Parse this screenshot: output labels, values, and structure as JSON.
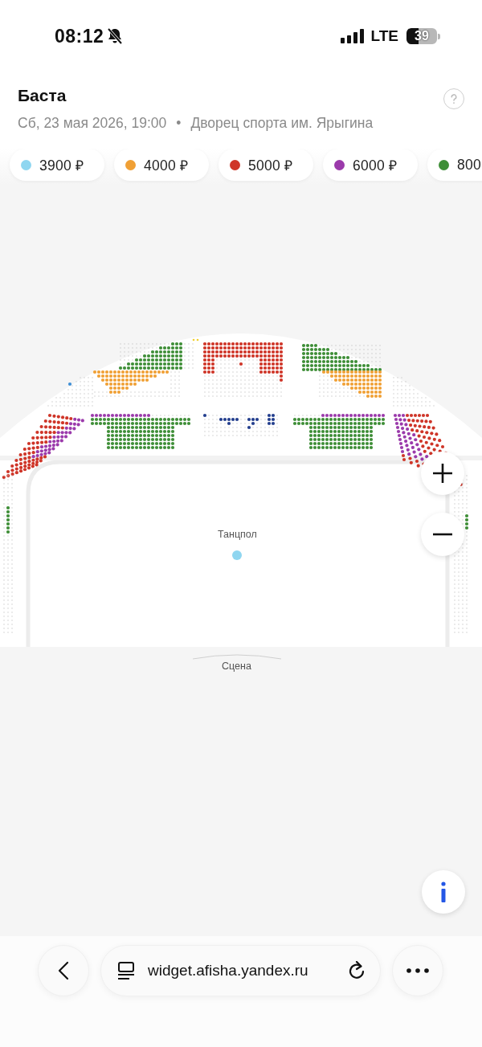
{
  "status_bar": {
    "time": "08:12",
    "network": "LTE",
    "battery": "39"
  },
  "event": {
    "title": "Баста",
    "date": "Сб, 23 мая 2026, 19:00",
    "separator": "•",
    "venue": "Дворец спорта им. Ярыгина"
  },
  "prices": [
    {
      "label": "3900 ₽",
      "color": "#8fd6f0"
    },
    {
      "label": "4000 ₽",
      "color": "#f0a035"
    },
    {
      "label": "5000 ₽",
      "color": "#cf3528"
    },
    {
      "label": "6000 ₽",
      "color": "#9b3aab"
    },
    {
      "label": "800",
      "color": "#3e8e37"
    }
  ],
  "map": {
    "dance_floor": "Танцпол",
    "stage": "Сцена"
  },
  "browser": {
    "url": "widget.afisha.yandex.ru"
  }
}
